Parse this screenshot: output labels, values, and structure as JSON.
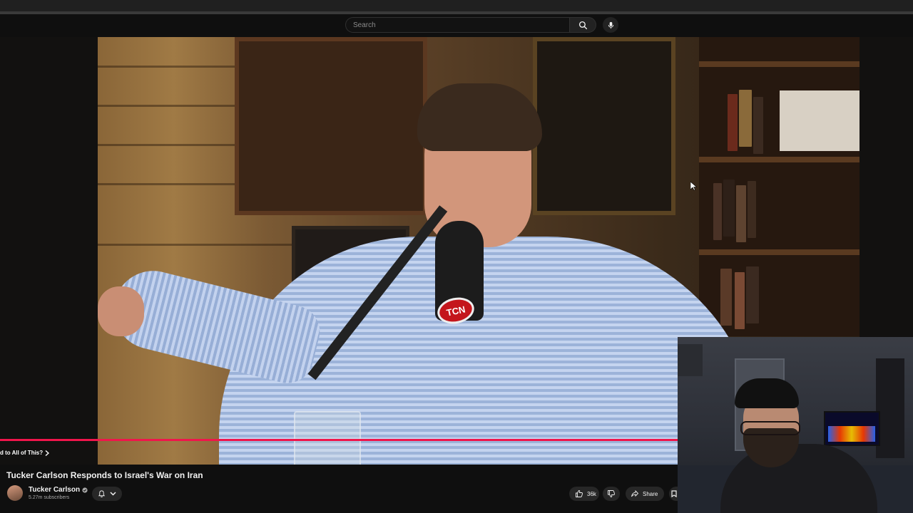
{
  "header": {
    "search_placeholder": "Search",
    "icons": [
      "search-icon",
      "mic-icon"
    ]
  },
  "player": {
    "chapter_label": "d to All of This?",
    "progress_fraction": 1.0,
    "mic_logo_text": "TCN",
    "progress_color": "#f0154b"
  },
  "video": {
    "title": "Tucker Carlson Responds to Israel's War on Iran",
    "channel_name": "Tucker Carlson",
    "subscribers": "5.27m subscribers",
    "likes": "36k",
    "share_label": "Share"
  },
  "colors": {
    "background": "#0f0f0f",
    "pill": "#272727",
    "text": "#f1f1f1",
    "muted_text": "#aaaaaa"
  }
}
